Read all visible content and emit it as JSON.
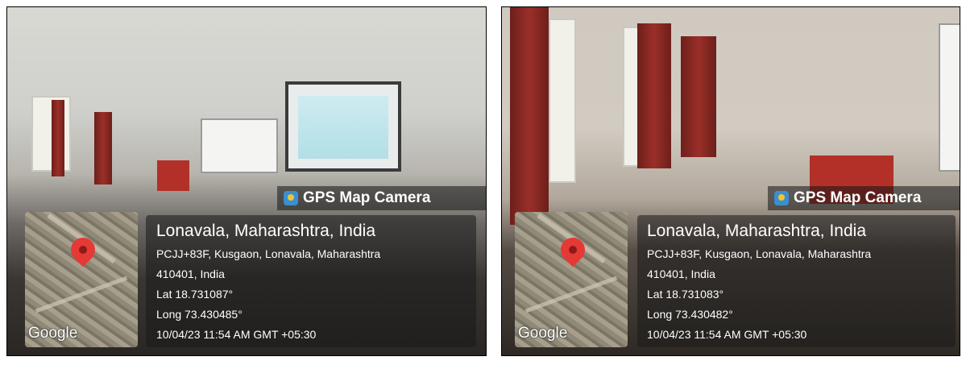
{
  "photos": [
    {
      "overlay": {
        "app_name": "GPS Map Camera",
        "map_attribution": "Google",
        "place": "Lonavala, Maharashtra, India",
        "address_line1": "PCJJ+83F, Kusgaon, Lonavala, Maharashtra",
        "address_line2": "410401, India",
        "lat": "Lat 18.731087°",
        "long": "Long 73.430485°",
        "datetime": "10/04/23 11:54 AM GMT +05:30"
      }
    },
    {
      "overlay": {
        "app_name": "GPS Map Camera",
        "map_attribution": "Google",
        "place": "Lonavala, Maharashtra, India",
        "address_line1": "PCJJ+83F, Kusgaon, Lonavala, Maharashtra",
        "address_line2": "410401, India",
        "lat": "Lat 18.731083°",
        "long": "Long 73.430482°",
        "datetime": "10/04/23 11:54 AM GMT +05:30"
      }
    }
  ],
  "icons": {
    "app_icon": "gps-map-camera-icon",
    "map_pin": "location-pin-icon"
  },
  "colors": {
    "pin": "#e53935",
    "curtain": "#9a2f28",
    "overlay_bg": "rgba(25,25,25,0.55)"
  }
}
